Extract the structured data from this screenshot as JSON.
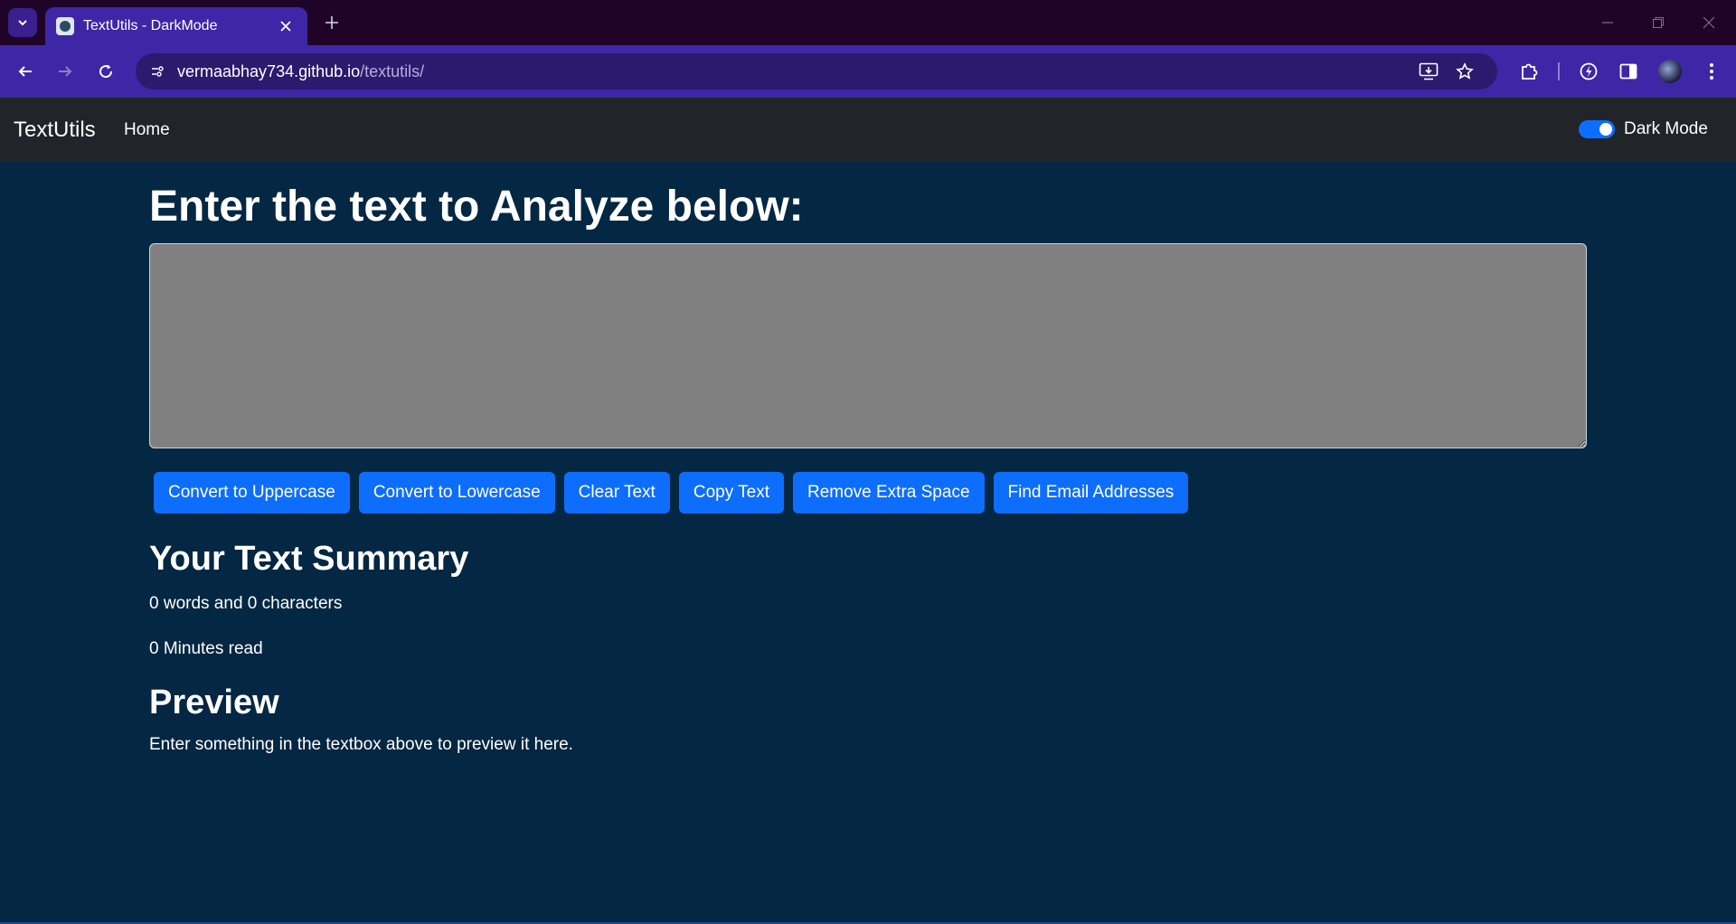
{
  "browser": {
    "tab_title": "TextUtils - DarkMode",
    "url_host": "vermaabhay734.github.io",
    "url_path": "/textutils/",
    "icons": [
      "tab-search-icon",
      "favicon",
      "close-icon",
      "plus-icon",
      "minimize-icon",
      "restore-icon",
      "window-close-icon",
      "back-arrow-icon",
      "forward-arrow-icon",
      "reload-icon",
      "site-info-icon",
      "install-app-icon",
      "star-icon",
      "extensions-icon",
      "performance-icon",
      "side-panel-icon",
      "avatar",
      "kebab-menu-icon"
    ],
    "colors": {
      "tabstrip": "#200428",
      "toolbar": "#3d27a6",
      "omnibox": "#2b1a6e"
    }
  },
  "navbar": {
    "brand": "TextUtils",
    "links": [
      "Home"
    ],
    "dark_mode_label": "Dark Mode",
    "dark_mode_on": true,
    "color": "#212529"
  },
  "main": {
    "heading": "Enter the text to Analyze below:",
    "textarea_value": "",
    "buttons": [
      "Convert to Uppercase",
      "Convert to Lowercase",
      "Clear Text",
      "Copy Text",
      "Remove Extra Space",
      "Find Email Addresses"
    ],
    "summary_title": "Your Text Summary",
    "word_char_count": "0 words and 0 characters",
    "read_time": "0 Minutes read",
    "preview_title": "Preview",
    "preview_text": "Enter something in the textbox above to preview it here.",
    "colors": {
      "background": "#042743",
      "button": "#0d6efd",
      "textarea": "#808080"
    }
  }
}
